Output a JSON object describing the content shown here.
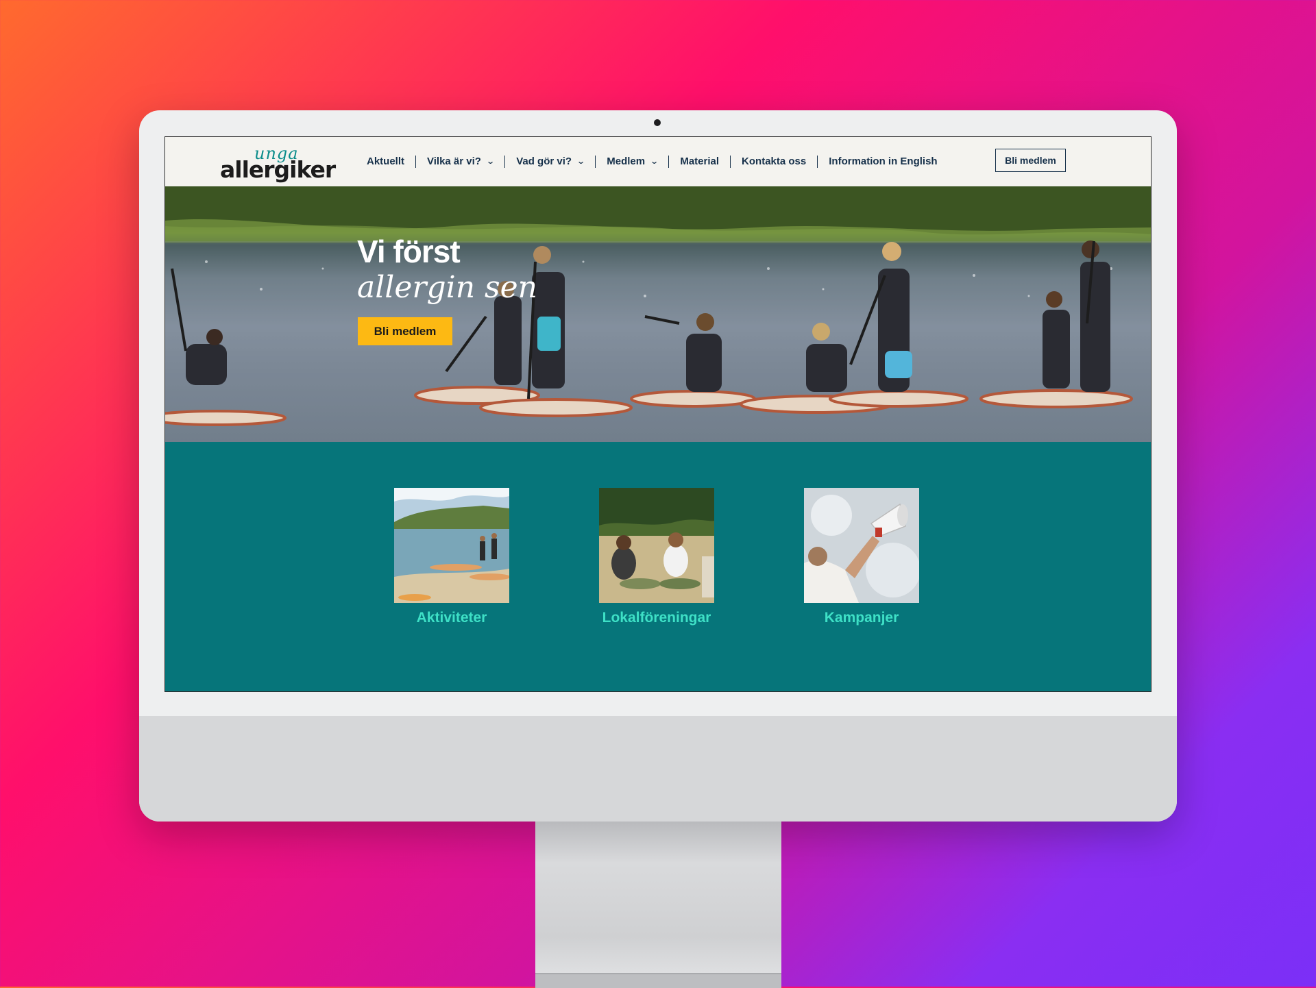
{
  "logo": {
    "top_word": "unga",
    "main_word": "allergiker"
  },
  "nav": {
    "items": [
      {
        "label": "Aktuellt",
        "has_dropdown": false
      },
      {
        "label": "Vilka är vi?",
        "has_dropdown": true
      },
      {
        "label": "Vad gör vi?",
        "has_dropdown": true
      },
      {
        "label": "Medlem",
        "has_dropdown": true
      },
      {
        "label": "Material",
        "has_dropdown": false
      },
      {
        "label": "Kontakta oss",
        "has_dropdown": false
      },
      {
        "label": "Information in English",
        "has_dropdown": false
      }
    ],
    "cta_label": "Bli medlem"
  },
  "hero": {
    "title_line1": "Vi först",
    "title_line2": "allergin sen",
    "cta_label": "Bli medlem",
    "cta_color": "#fdb913"
  },
  "cards": [
    {
      "label": "Aktiviteter"
    },
    {
      "label": "Lokalföreningar"
    },
    {
      "label": "Kampanjer"
    }
  ],
  "colors": {
    "teal_bg": "#06757a",
    "card_label": "#3ee0c6",
    "nav_text": "#16304a",
    "header_bg": "#f4f3ef"
  }
}
